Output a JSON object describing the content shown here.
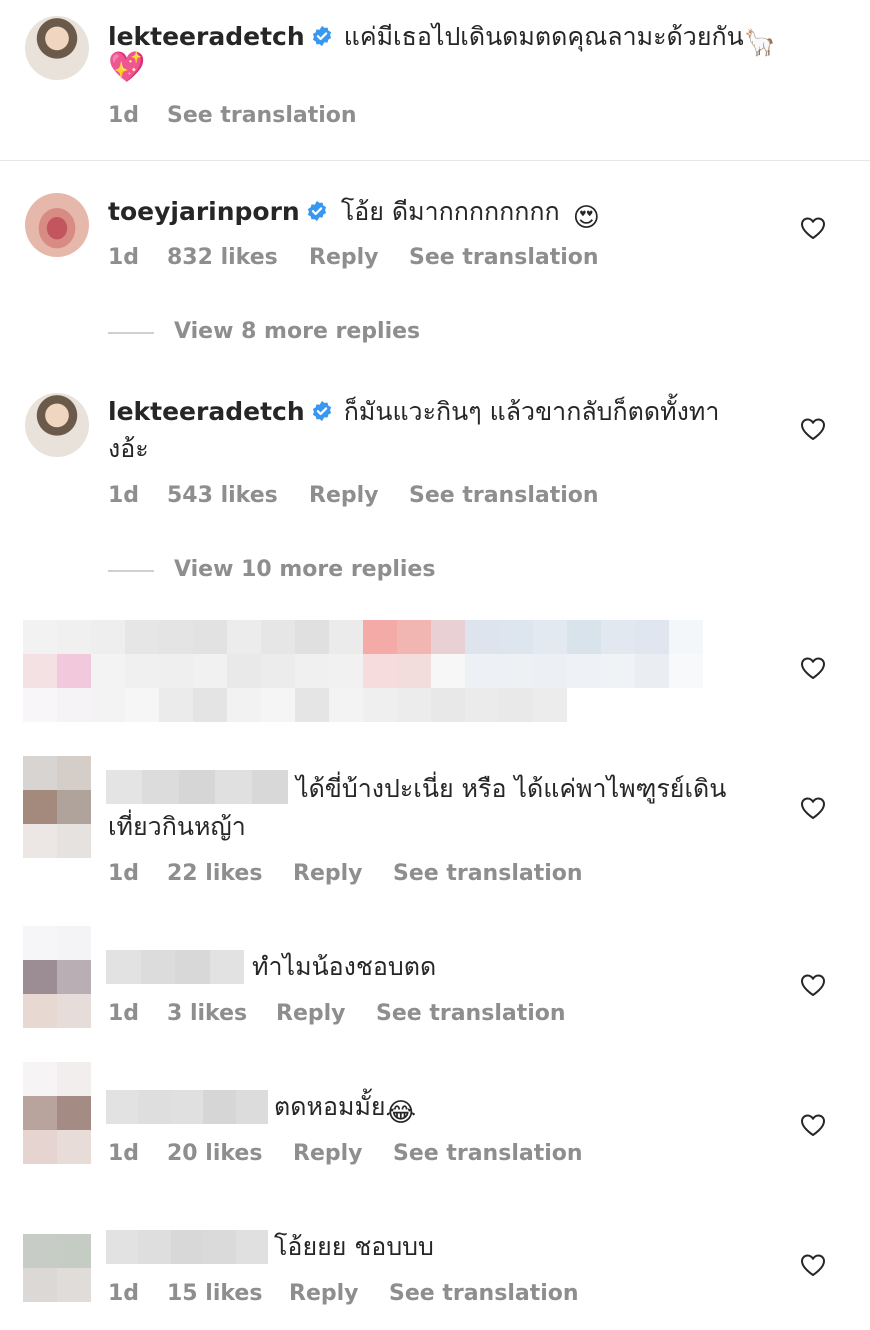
{
  "comments": [
    {
      "username": "lekteeradetch",
      "text_line1": "แค่มีเธอไปเดินดมตดคุณลามะด้วยกัน",
      "emoji_1": "🦙",
      "emoji_2": "💖",
      "time": "1d",
      "see_translation": "See translation"
    },
    {
      "username": "toeyjarinporn",
      "text": "โอ้ย ดีมากกกกกกกก",
      "emoji": "😍",
      "time": "1d",
      "likes": "832 likes",
      "reply": "Reply",
      "see_translation": "See translation",
      "view_more": "View 8 more replies"
    },
    {
      "username": "lekteeradetch",
      "text_line1": "ก็มันแวะกินๆ แล้วขากลับก็ตดทั้งทา",
      "text_line2": "งอ้ะ",
      "time": "1d",
      "likes": "543 likes",
      "reply": "Reply",
      "see_translation": "See translation",
      "view_more": "View 10 more replies"
    },
    {
      "text_line1": "ได้ขี่บ้างปะเนี่ย หรือ ได้แค่พาไพฑูรย์เดิน",
      "text_line2": "เที่ยวกินหญ้า",
      "time": "1d",
      "likes": "22 likes",
      "reply": "Reply",
      "see_translation": "See translation"
    },
    {
      "text": "ทำไมน้องชอบตด",
      "time": "1d",
      "likes": "3 likes",
      "reply": "Reply",
      "see_translation": "See translation"
    },
    {
      "text": "ตดหอมมั้ย",
      "emoji": "😂",
      "time": "1d",
      "likes": "20 likes",
      "reply": "Reply",
      "see_translation": "See translation"
    },
    {
      "text": "โอ้ยยย ชอบบบ",
      "time": "1d",
      "likes": "15 likes",
      "reply": "Reply",
      "see_translation": "See translation"
    }
  ],
  "colors": {
    "text": "#262626",
    "muted": "#8e8e8e",
    "verified": "#3897f0"
  }
}
